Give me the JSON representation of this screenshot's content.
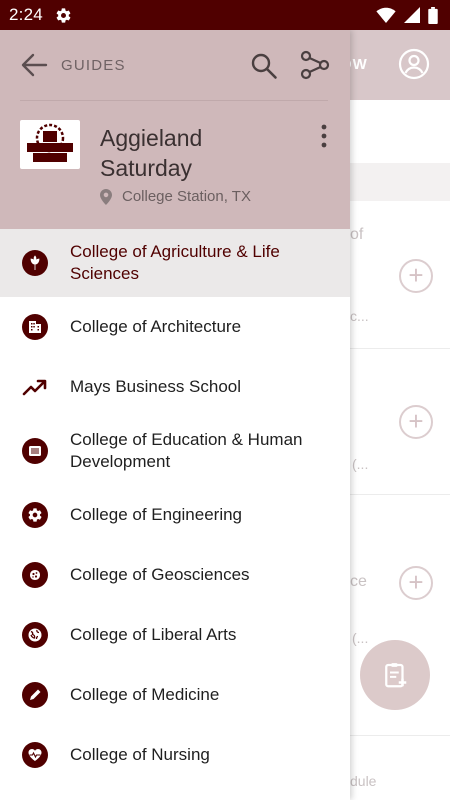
{
  "status_bar": {
    "time": "2:24"
  },
  "background": {
    "follow_label": "OW",
    "faded_texts": [
      "of",
      "c...",
      "(...",
      "ce",
      "(...",
      "dule"
    ]
  },
  "drawer": {
    "back_label": "GUIDES",
    "guide": {
      "logo_text": "AGGIELAND SATURDAY",
      "title": "Aggieland Saturday",
      "location": "College Station, TX"
    },
    "items": [
      {
        "label": "College of Agriculture & Life Sciences",
        "icon": "leaf-icon",
        "selected": true
      },
      {
        "label": "College of Architecture",
        "icon": "building-icon",
        "selected": false
      },
      {
        "label": "Mays Business School",
        "icon": "trending-up-icon",
        "selected": false
      },
      {
        "label": "College of Education & Human Development",
        "icon": "document-icon",
        "selected": false
      },
      {
        "label": "College of Engineering",
        "icon": "gear-icon",
        "selected": false
      },
      {
        "label": "College of Geosciences",
        "icon": "rock-icon",
        "selected": false
      },
      {
        "label": "College of Liberal Arts",
        "icon": "globe-icon",
        "selected": false
      },
      {
        "label": "College of Medicine",
        "icon": "pencil-icon",
        "selected": false
      },
      {
        "label": "College of Nursing",
        "icon": "heart-pulse-icon",
        "selected": false
      }
    ]
  },
  "colors": {
    "brand": "#500000",
    "drawer_header": "#cfb8ba",
    "app_bar": "#d8c7c9",
    "selected_row": "#ebe9e9"
  }
}
